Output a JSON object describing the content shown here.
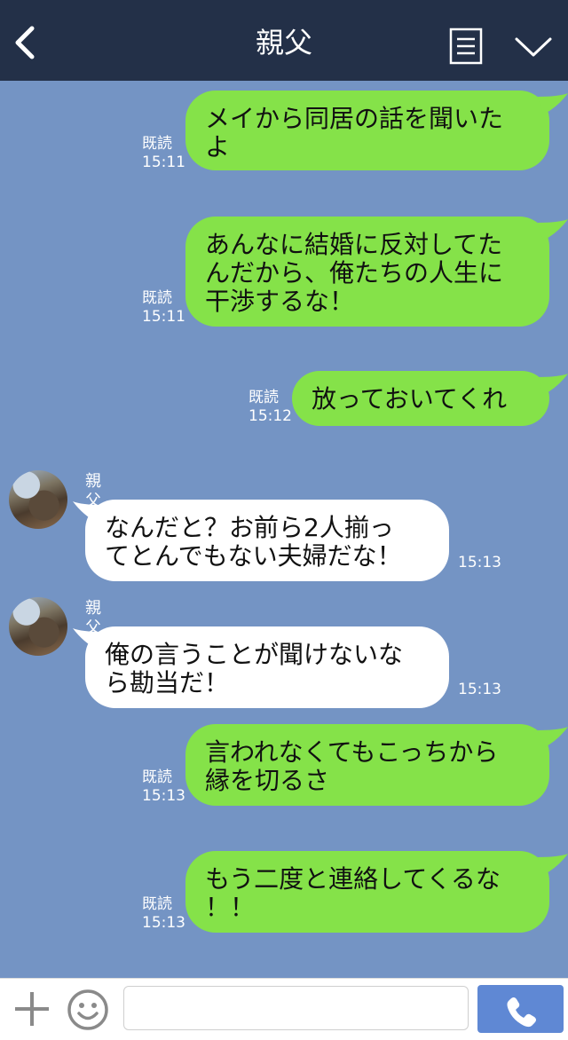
{
  "header": {
    "title": "親父",
    "back_icon": "chevron-left-icon",
    "menu_icon": "document-list-icon",
    "expand_icon": "chevron-down-icon"
  },
  "colors": {
    "header_bg": "#233048",
    "chat_bg": "#7494c4",
    "my_bubble": "#85e249",
    "their_bubble": "#ffffff",
    "call_button": "#5f88d4"
  },
  "messages": [
    {
      "from": "me",
      "text": "メイから同居の話を聞いた\nよ",
      "read": "既読",
      "time": "15:11"
    },
    {
      "from": "me",
      "text": "あんなに結婚に反対してた\nんだから、俺たちの人生に\n干渉するな！",
      "read": "既読",
      "time": "15:11"
    },
    {
      "from": "me",
      "text": "放っておいてくれ",
      "read": "既読",
      "time": "15:12"
    },
    {
      "from": "them",
      "sender": "親父",
      "text": "なんだと？お前ら2人揃っ\nてとんでもない夫婦だな！",
      "time": "15:13"
    },
    {
      "from": "them",
      "sender": "親父",
      "text": "俺の言うことが聞けないな\nら勘当だ！",
      "time": "15:13"
    },
    {
      "from": "me",
      "text": "言われなくてもこっちから\n縁を切るさ",
      "read": "既読",
      "time": "15:13"
    },
    {
      "from": "me",
      "text": "もう二度と連絡してくるな\n！！",
      "read": "既読",
      "time": "15:13"
    }
  ],
  "footer": {
    "plus_icon": "plus-icon",
    "emoji_icon": "smiley-icon",
    "input_value": "",
    "call_icon": "phone-icon"
  }
}
